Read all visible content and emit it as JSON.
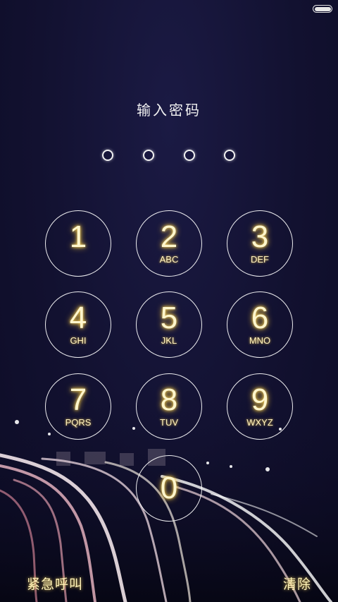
{
  "statusbar": {
    "battery_icon": "battery-icon"
  },
  "lockscreen": {
    "title": "输入密码",
    "passcode_length": 4,
    "emergency_label": "紧急呼叫",
    "clear_label": "清除",
    "accent_color": "#fff3b8",
    "background_color": "#11102e"
  },
  "keypad": [
    {
      "digit": "1",
      "letters": ""
    },
    {
      "digit": "2",
      "letters": "ABC"
    },
    {
      "digit": "3",
      "letters": "DEF"
    },
    {
      "digit": "4",
      "letters": "GHI"
    },
    {
      "digit": "5",
      "letters": "JKL"
    },
    {
      "digit": "6",
      "letters": "MNO"
    },
    {
      "digit": "7",
      "letters": "PQRS"
    },
    {
      "digit": "8",
      "letters": "TUV"
    },
    {
      "digit": "9",
      "letters": "WXYZ"
    },
    {
      "digit": "0",
      "letters": ""
    }
  ]
}
